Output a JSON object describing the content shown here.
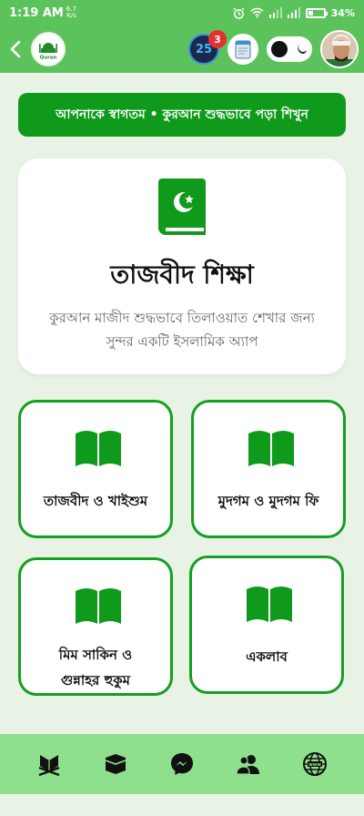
{
  "status_bar": {
    "time": "1:19 AM",
    "net_speed_top": "6.7",
    "net_speed_bottom": "K/s",
    "battery": "34%",
    "battery_level": 0.34
  },
  "app_bar": {
    "logo_text": "Quran",
    "counter_value": "25",
    "counter_badge": "3"
  },
  "welcome_banner": "আপনাকে স্বাগতম • কুরআন শুদ্ধভাবে পড়া শিখুন",
  "hero": {
    "title": "তাজবীদ শিক্ষা",
    "description": "কুরআন মাজীদ শুদ্ধভাবে তিলাওয়াত শেখার জন্য সুন্দর একটি ইসলামিক অ্যাপ"
  },
  "cards": [
    {
      "label": "তাজবীদ ও খাইশুম"
    },
    {
      "label": "মুদগম ও মুদগম ফি"
    },
    {
      "label": "মিম সাকিন ও গুন্নাহর হুকুম"
    },
    {
      "label": "একলাব"
    }
  ],
  "bottom_nav": [
    "quran-icon",
    "kaaba-icon",
    "messenger-icon",
    "group-icon",
    "globe-icon"
  ],
  "colors": {
    "status_green": "#5cc35c",
    "primary_green": "#0f9a1c",
    "card_border": "#14a01f",
    "nav_green": "#8fe08c",
    "background": "#e8f3e6"
  }
}
